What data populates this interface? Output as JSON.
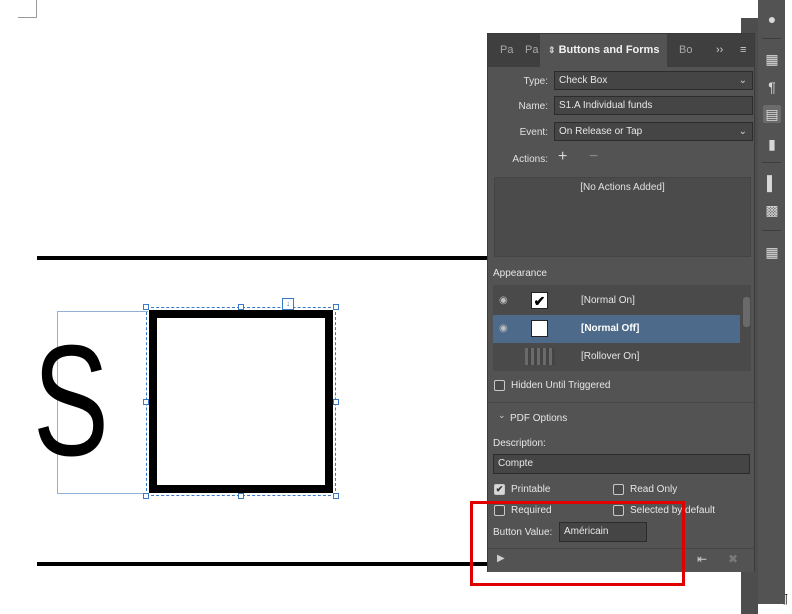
{
  "panel": {
    "tabs": {
      "tab1": "Pa",
      "tab2": "Pa",
      "active": "Buttons and Forms",
      "tab4": "Bo",
      "overflow": "››",
      "menu": "≡"
    },
    "type_label": "Type:",
    "type_value": "Check Box",
    "name_label": "Name:",
    "name_value": "S1.A Individual funds",
    "event_label": "Event:",
    "event_value": "On Release or Tap",
    "actions_label": "Actions:",
    "actions_add": "+",
    "actions_remove": "−",
    "actions_empty": "[No Actions Added]",
    "appearance_title": "Appearance",
    "appearance_items": [
      {
        "label": "[Normal On]",
        "thumb": "✔"
      },
      {
        "label": "[Normal Off]",
        "thumb": ""
      },
      {
        "label": "[Rollover On]",
        "thumb": ""
      }
    ],
    "hidden_label": "Hidden Until Triggered",
    "pdf_options_label": "PDF Options",
    "pdf_options_chevron": "⌄",
    "description_label": "Description:",
    "description_value": "Compte",
    "printable_label": "Printable",
    "read_only_label": "Read Only",
    "required_label": "Required",
    "selected_default_label": "Selected by default",
    "button_value_label": "Button Value:",
    "button_value": "Américain"
  },
  "canvas": {
    "letter": "S",
    "anchor_glyph": "↓",
    "para_mark": "¶"
  },
  "icons": {
    "chevron": "⌄",
    "eye": "◉",
    "check": "✔",
    "preview": "▶",
    "convert": "⇤",
    "trash": "✖"
  },
  "colors": {
    "panel_bg": "#535353",
    "selected_row": "#4d6a8a",
    "highlight": "#e00000",
    "frame": "#3a78c8"
  }
}
